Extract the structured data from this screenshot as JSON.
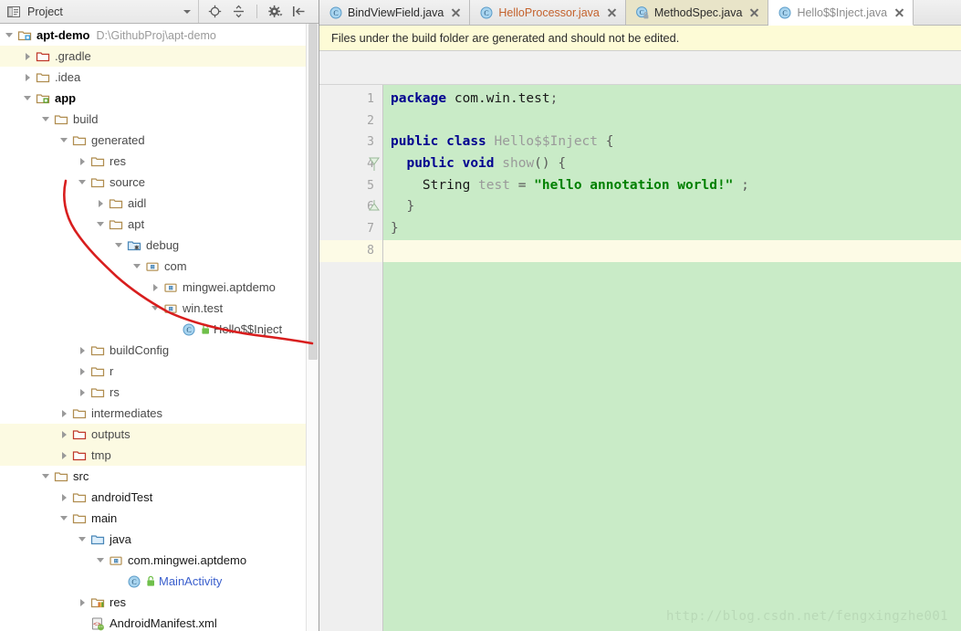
{
  "project_panel": {
    "header": {
      "title": "Project",
      "icon": "project-view-icon",
      "dropdown_icon": "chevron-down-icon",
      "toolbar": [
        {
          "name": "locate-in-tree-icon",
          "label": "Scroll from Source"
        },
        {
          "name": "collapse-all-icon",
          "label": "Collapse All"
        },
        {
          "name": "gear-icon",
          "label": "Settings"
        },
        {
          "name": "hide-panel-icon",
          "label": "Hide"
        }
      ]
    },
    "tree": [
      {
        "label": "apt-demo",
        "path": "D:\\GithubProj\\apt-demo",
        "depth": 0,
        "arrow": "open",
        "icon": "module-root-icon",
        "style": "bold",
        "highlight": false
      },
      {
        "label": ".gradle",
        "depth": 1,
        "arrow": "closed",
        "icon": "folder-excluded-icon",
        "style": "normal",
        "highlight": true
      },
      {
        "label": ".idea",
        "depth": 1,
        "arrow": "closed",
        "icon": "folder-icon",
        "style": "normal",
        "highlight": false
      },
      {
        "label": "app",
        "depth": 1,
        "arrow": "open",
        "icon": "module-icon",
        "style": "bold",
        "highlight": false
      },
      {
        "label": "build",
        "depth": 2,
        "arrow": "open",
        "icon": "folder-icon",
        "style": "normal",
        "highlight": false
      },
      {
        "label": "generated",
        "depth": 3,
        "arrow": "open",
        "icon": "folder-icon",
        "style": "normal",
        "highlight": false
      },
      {
        "label": "res",
        "depth": 4,
        "arrow": "closed",
        "icon": "folder-icon",
        "style": "normal",
        "highlight": false
      },
      {
        "label": "source",
        "depth": 4,
        "arrow": "open",
        "icon": "folder-icon",
        "style": "normal",
        "highlight": false
      },
      {
        "label": "aidl",
        "depth": 5,
        "arrow": "closed",
        "icon": "folder-icon",
        "style": "normal",
        "highlight": false
      },
      {
        "label": "apt",
        "depth": 5,
        "arrow": "open",
        "icon": "folder-icon",
        "style": "normal",
        "highlight": false
      },
      {
        "label": "debug",
        "depth": 6,
        "arrow": "open",
        "icon": "source-root-icon",
        "style": "normal",
        "highlight": false
      },
      {
        "label": "com",
        "depth": 7,
        "arrow": "open",
        "icon": "package-icon",
        "style": "normal",
        "highlight": false
      },
      {
        "label": "mingwei.aptdemo",
        "depth": 8,
        "arrow": "closed",
        "icon": "package-icon",
        "style": "normal",
        "highlight": false
      },
      {
        "label": "win.test",
        "depth": 8,
        "arrow": "open",
        "icon": "package-icon",
        "style": "normal",
        "highlight": false
      },
      {
        "label": "Hello$$Inject",
        "depth": 9,
        "arrow": "none",
        "icon": "java-class-icon",
        "badge": "lock-icon",
        "style": "normal",
        "highlight": false
      },
      {
        "label": "buildConfig",
        "depth": 4,
        "arrow": "closed",
        "icon": "folder-icon",
        "style": "normal",
        "highlight": false
      },
      {
        "label": "r",
        "depth": 4,
        "arrow": "closed",
        "icon": "folder-icon",
        "style": "normal",
        "highlight": false
      },
      {
        "label": "rs",
        "depth": 4,
        "arrow": "closed",
        "icon": "folder-icon",
        "style": "normal",
        "highlight": false
      },
      {
        "label": "intermediates",
        "depth": 3,
        "arrow": "closed",
        "icon": "folder-icon",
        "style": "normal",
        "highlight": false
      },
      {
        "label": "outputs",
        "depth": 3,
        "arrow": "closed",
        "icon": "folder-excluded-icon",
        "style": "normal",
        "highlight": true
      },
      {
        "label": "tmp",
        "depth": 3,
        "arrow": "closed",
        "icon": "folder-excluded-icon",
        "style": "normal",
        "highlight": true
      },
      {
        "label": "src",
        "depth": 2,
        "arrow": "open",
        "icon": "folder-icon",
        "style": "dark",
        "highlight": false
      },
      {
        "label": "androidTest",
        "depth": 3,
        "arrow": "closed",
        "icon": "folder-icon",
        "style": "dark",
        "highlight": false
      },
      {
        "label": "main",
        "depth": 3,
        "arrow": "open",
        "icon": "folder-icon",
        "style": "dark",
        "highlight": false
      },
      {
        "label": "java",
        "depth": 4,
        "arrow": "open",
        "icon": "source-folder-icon",
        "style": "dark",
        "highlight": false
      },
      {
        "label": "com.mingwei.aptdemo",
        "depth": 5,
        "arrow": "open",
        "icon": "package-icon",
        "style": "dark",
        "highlight": false
      },
      {
        "label": "MainActivity",
        "depth": 6,
        "arrow": "none",
        "icon": "java-class-icon",
        "badge": "lock-icon",
        "style": "blue",
        "highlight": false
      },
      {
        "label": "res",
        "depth": 4,
        "arrow": "closed",
        "icon": "res-folder-icon",
        "style": "dark",
        "highlight": false
      },
      {
        "label": "AndroidManifest.xml",
        "depth": 4,
        "arrow": "none",
        "icon": "android-manifest-icon",
        "style": "dark",
        "highlight": false
      }
    ]
  },
  "editor": {
    "tabs": [
      {
        "label": "BindViewField.java",
        "icon": "java-class-icon",
        "state": "inactive",
        "color": "black",
        "close_icon": "close-icon"
      },
      {
        "label": "HelloProcessor.java",
        "icon": "java-class-icon",
        "state": "inactive",
        "color": "orange",
        "close_icon": "close-icon"
      },
      {
        "label": "MethodSpec.java",
        "icon": "java-class-locked-icon",
        "state": "selected-olive",
        "color": "black",
        "close_icon": "close-icon"
      },
      {
        "label": "Hello$$Inject.java",
        "icon": "java-class-icon",
        "state": "active",
        "color": "gray",
        "close_icon": "close-icon"
      }
    ],
    "notice": "Files under the build folder are generated and should not be edited.",
    "line_numbers": [
      "1",
      "2",
      "3",
      "4",
      "5",
      "6",
      "7",
      "8"
    ],
    "caret_line": 8,
    "fold_markers": [
      {
        "line": 4,
        "type": "fold-open-icon"
      },
      {
        "line": 6,
        "type": "fold-end-icon"
      }
    ],
    "code_lines": [
      {
        "n": 1,
        "tokens": [
          {
            "t": "package",
            "c": "kw"
          },
          {
            "t": " com.",
            "c": "plain"
          },
          {
            "t": "win.",
            "c": "plain"
          },
          {
            "t": "test",
            "c": "plain"
          },
          {
            "t": ";",
            "c": "punct"
          }
        ]
      },
      {
        "n": 2,
        "tokens": []
      },
      {
        "n": 3,
        "tokens": [
          {
            "t": "public",
            "c": "kw"
          },
          {
            "t": " ",
            "c": "plain"
          },
          {
            "t": "class",
            "c": "kw"
          },
          {
            "t": " ",
            "c": "plain"
          },
          {
            "t": "Hello$$Inject",
            "c": "ident"
          },
          {
            "t": " ",
            "c": "plain"
          },
          {
            "t": "{",
            "c": "punct"
          }
        ]
      },
      {
        "n": 4,
        "tokens": [
          {
            "t": "  ",
            "c": "plain"
          },
          {
            "t": "public",
            "c": "kw"
          },
          {
            "t": " ",
            "c": "plain"
          },
          {
            "t": "void",
            "c": "kw"
          },
          {
            "t": " ",
            "c": "plain"
          },
          {
            "t": "show",
            "c": "ident"
          },
          {
            "t": "()",
            "c": "punct"
          },
          {
            "t": " ",
            "c": "plain"
          },
          {
            "t": "{",
            "c": "punct"
          }
        ]
      },
      {
        "n": 5,
        "tokens": [
          {
            "t": "    ",
            "c": "plain"
          },
          {
            "t": "String",
            "c": "plain"
          },
          {
            "t": " ",
            "c": "plain"
          },
          {
            "t": "test",
            "c": "ident"
          },
          {
            "t": " ",
            "c": "plain"
          },
          {
            "t": "=",
            "c": "punct"
          },
          {
            "t": " ",
            "c": "plain"
          },
          {
            "t": "\"hello annotation world!\"",
            "c": "str"
          },
          {
            "t": " ;",
            "c": "punct"
          }
        ]
      },
      {
        "n": 6,
        "tokens": [
          {
            "t": "  ",
            "c": "plain"
          },
          {
            "t": "}",
            "c": "punct"
          }
        ]
      },
      {
        "n": 7,
        "tokens": [
          {
            "t": "}",
            "c": "punct"
          }
        ]
      },
      {
        "n": 8,
        "tokens": []
      }
    ],
    "watermark": "http://blog.csdn.net/fengxingzhe001"
  },
  "colors": {
    "editor_background": "#c9ebc7",
    "caret_line": "#fdfbe6",
    "notice_background": "#fdfbd6",
    "tree_highlight": "#fcfae2",
    "annotation_red": "#d81e1e",
    "keyword_blue": "#00008f",
    "string_green": "#008000",
    "active_tab": "#ffffff",
    "selected_tab": "#e8e4c8"
  }
}
